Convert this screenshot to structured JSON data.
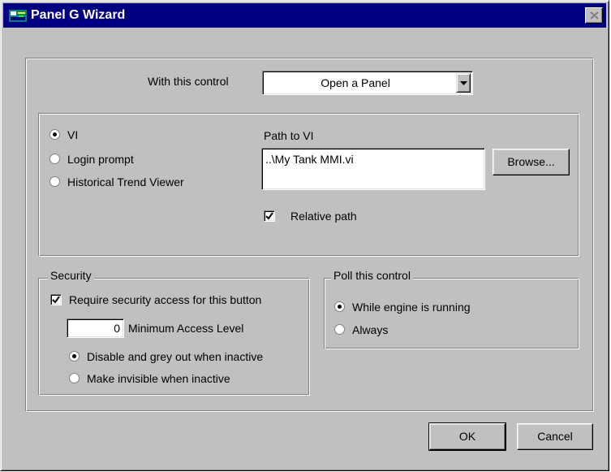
{
  "window": {
    "title": "Panel G Wizard"
  },
  "control": {
    "label": "With this control",
    "selected": "Open a Panel"
  },
  "target": {
    "options": [
      {
        "label": "VI",
        "checked": true
      },
      {
        "label": "Login prompt",
        "checked": false
      },
      {
        "label": "Historical Trend Viewer",
        "checked": false
      }
    ],
    "path_label": "Path to VI",
    "path_value": "..\\My Tank MMI.vi",
    "browse_label": "Browse...",
    "relative_label": "Relative path",
    "relative_checked": true
  },
  "security": {
    "legend": "Security",
    "require_label": "Require security access for this button",
    "require_checked": true,
    "access_level": "0",
    "access_label": "Minimum Access Level",
    "options": [
      {
        "label": "Disable and grey out when inactive",
        "checked": true
      },
      {
        "label": "Make invisible when inactive",
        "checked": false
      }
    ]
  },
  "poll": {
    "legend": "Poll this control",
    "options": [
      {
        "label": "While engine is running",
        "checked": true
      },
      {
        "label": "Always",
        "checked": false
      }
    ]
  },
  "buttons": {
    "ok": "OK",
    "cancel": "Cancel"
  },
  "icons": {
    "title": "panel-wizard-icon",
    "close": "close-icon",
    "dropdown": "chevron-down-icon"
  },
  "colors": {
    "titlebar": "#000080",
    "face": "#c0c0c0"
  }
}
